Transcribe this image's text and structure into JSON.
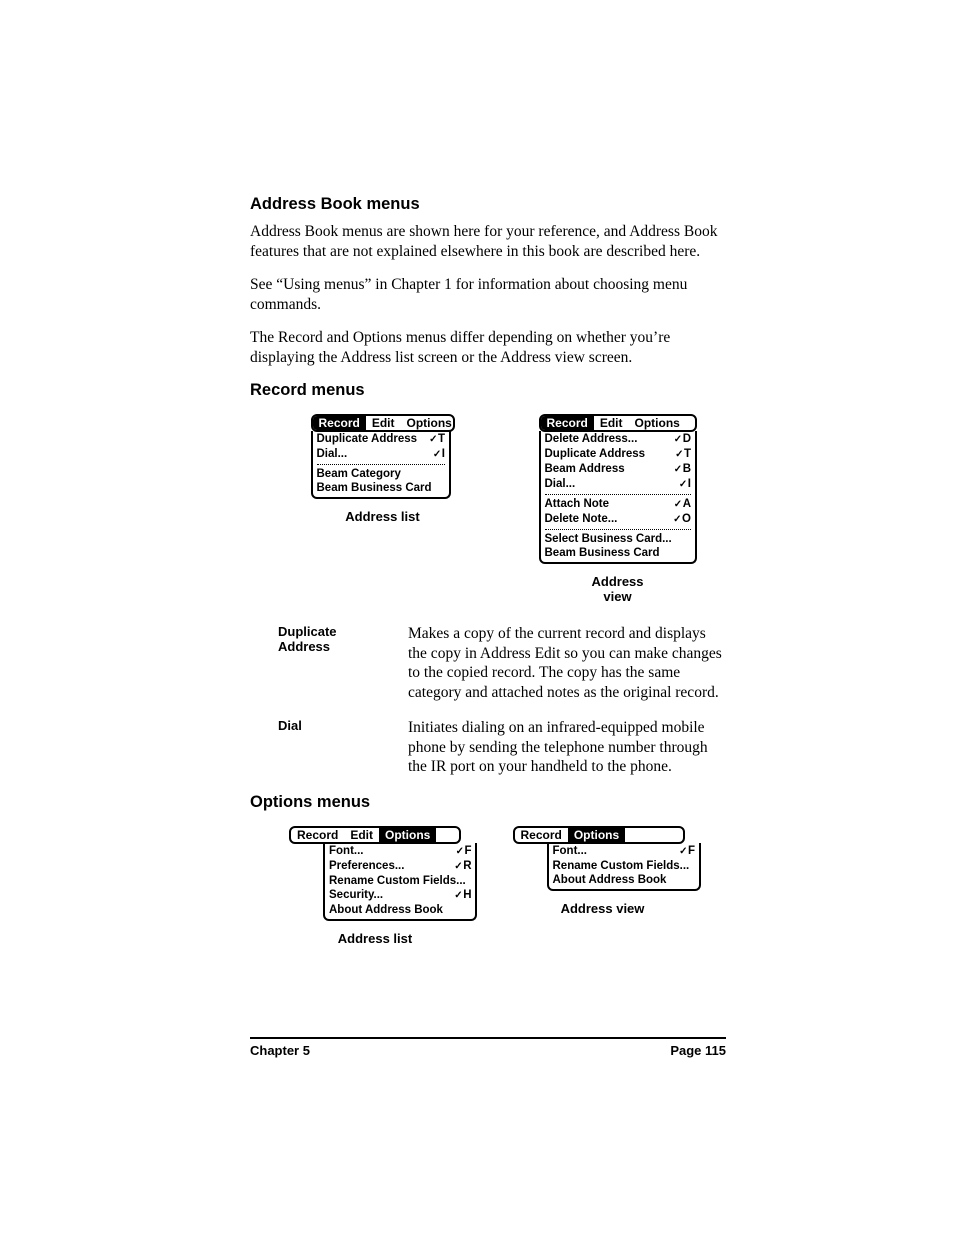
{
  "h_main": "Address Book menus",
  "p1": "Address Book menus are shown here for your reference, and Address Book features that are not explained elsewhere in this book are described here.",
  "p2": "See “Using menus” in Chapter 1 for information about choosing menu commands.",
  "p3": "The Record and Options menus differ depending on whether you’re displaying the Address list screen or the Address view screen.",
  "h_record": "Record menus",
  "h_options": "Options menus",
  "tabs": {
    "record": "Record",
    "edit": "Edit",
    "options": "Options"
  },
  "record_list": {
    "caption": "Address list",
    "items": [
      {
        "label": "Duplicate Address",
        "key": "T"
      },
      {
        "label": "Dial...",
        "key": "I"
      },
      null,
      {
        "label": "Beam Category",
        "key": ""
      },
      {
        "label": "Beam Business Card",
        "key": ""
      }
    ]
  },
  "record_view": {
    "caption": "Address\nview",
    "items_g1": [
      {
        "label": "Delete Address...",
        "key": "D"
      },
      {
        "label": "Duplicate Address",
        "key": "T"
      },
      {
        "label": "Beam Address",
        "key": "B"
      },
      {
        "label": "Dial...",
        "key": "I"
      }
    ],
    "items_g2": [
      {
        "label": "Attach Note",
        "key": "A"
      },
      {
        "label": "Delete Note...",
        "key": "O"
      }
    ],
    "items_g3": [
      {
        "label": "Select Business Card...",
        "key": ""
      },
      {
        "label": "Beam Business Card",
        "key": ""
      }
    ]
  },
  "defs": [
    {
      "term": "Duplicate\nAddress",
      "desc": "Makes a copy of the current record and displays the copy in Address Edit so you can make changes to the copied record. The copy has the same category and attached notes as the original record."
    },
    {
      "term": "Dial",
      "desc": "Initiates dialing on an infrared-equipped mobile phone by sending the telephone number through the IR port on your handheld to the phone."
    }
  ],
  "options_list": {
    "caption": "Address list",
    "items": [
      {
        "label": "Font...",
        "key": "F"
      },
      {
        "label": "Preferences...",
        "key": "R"
      },
      {
        "label": "Rename Custom Fields...",
        "key": ""
      },
      {
        "label": "Security...",
        "key": "H"
      },
      {
        "label": "About Address Book",
        "key": ""
      }
    ]
  },
  "options_view": {
    "caption": "Address view",
    "items": [
      {
        "label": "Font...",
        "key": "F"
      },
      {
        "label": "Rename Custom Fields...",
        "key": ""
      },
      {
        "label": "About Address Book",
        "key": ""
      }
    ]
  },
  "footer": {
    "left": "Chapter 5",
    "right": "Page 115"
  }
}
